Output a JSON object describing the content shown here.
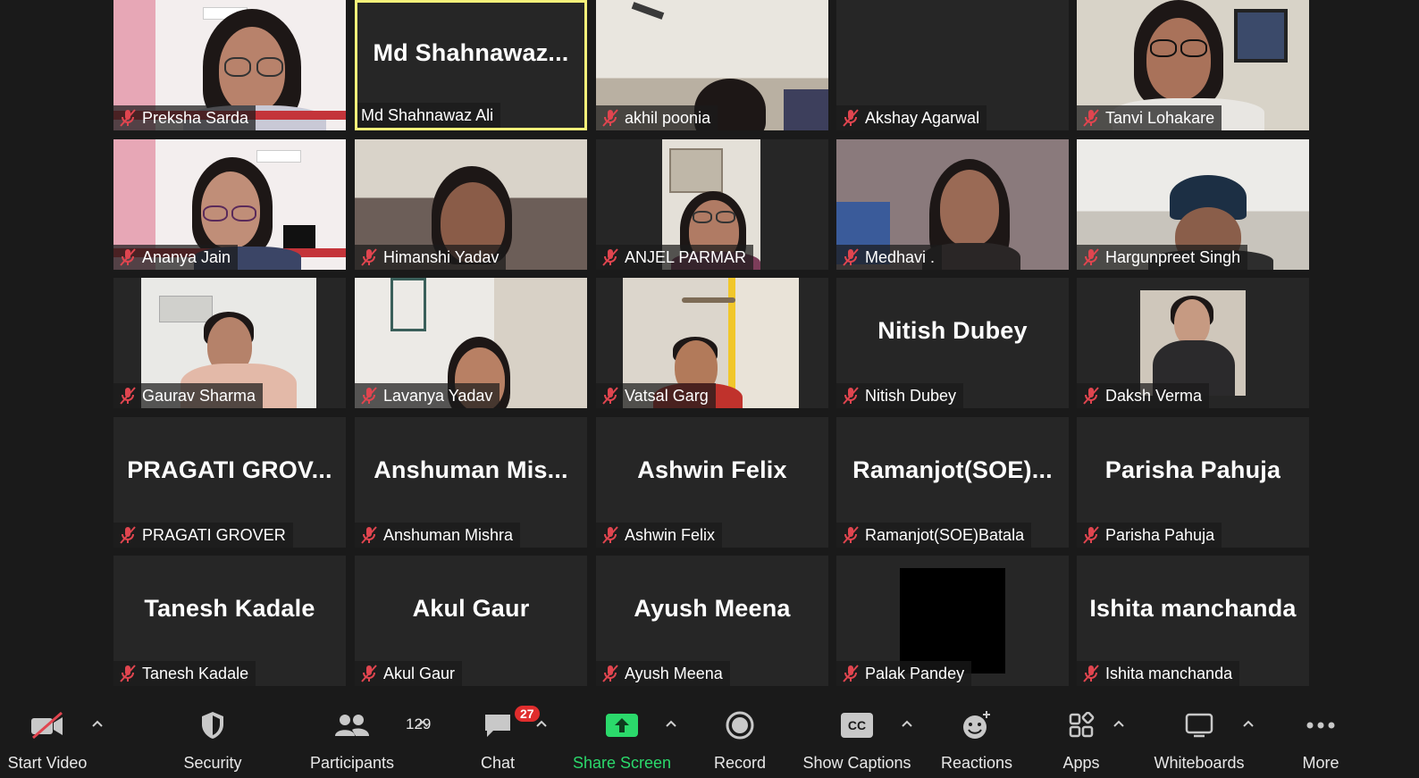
{
  "meeting": {
    "participants": [
      {
        "label": "Preksha Sarda",
        "display": "video",
        "muted": true
      },
      {
        "label": "Md Shahnawaz Ali",
        "display": "name",
        "big_name": "Md  Shahnawaz...",
        "muted": false,
        "active_speaker": true
      },
      {
        "label": "akhil poonia",
        "display": "video",
        "muted": true
      },
      {
        "label": "Akshay Agarwal",
        "display": "blank",
        "muted": true
      },
      {
        "label": "Tanvi Lohakare",
        "display": "video",
        "muted": true
      },
      {
        "label": "Ananya Jain",
        "display": "video",
        "muted": true
      },
      {
        "label": "Himanshi Yadav",
        "display": "video",
        "muted": true
      },
      {
        "label": "ANJEL PARMAR",
        "display": "video",
        "muted": true
      },
      {
        "label": "Medhavi .",
        "display": "video",
        "muted": true
      },
      {
        "label": "Hargunpreet Singh",
        "display": "video",
        "muted": true
      },
      {
        "label": "Gaurav Sharma",
        "display": "video",
        "muted": true
      },
      {
        "label": "Lavanya Yadav",
        "display": "video",
        "muted": true
      },
      {
        "label": "Vatsal Garg",
        "display": "video",
        "muted": true
      },
      {
        "label": "Nitish Dubey",
        "display": "name",
        "big_name": "Nitish Dubey",
        "muted": true
      },
      {
        "label": "Daksh Verma",
        "display": "video",
        "muted": true
      },
      {
        "label": "PRAGATI GROVER",
        "display": "name",
        "big_name": "PRAGATI  GROV...",
        "muted": true
      },
      {
        "label": "Anshuman Mishra",
        "display": "name",
        "big_name": "Anshuman  Mis...",
        "muted": true
      },
      {
        "label": "Ashwin Felix",
        "display": "name",
        "big_name": "Ashwin Felix",
        "muted": true
      },
      {
        "label": "Ramanjot(SOE)Batala",
        "display": "name",
        "big_name": "Ramanjot(SOE)...",
        "muted": true
      },
      {
        "label": "Parisha Pahuja",
        "display": "name",
        "big_name": "Parisha Pahuja",
        "muted": true
      },
      {
        "label": "Tanesh Kadale",
        "display": "name",
        "big_name": "Tanesh Kadale",
        "muted": true
      },
      {
        "label": "Akul Gaur",
        "display": "name",
        "big_name": "Akul Gaur",
        "muted": true
      },
      {
        "label": "Ayush Meena",
        "display": "name",
        "big_name": "Ayush Meena",
        "muted": true
      },
      {
        "label": "Palak Pandey",
        "display": "video",
        "muted": true
      },
      {
        "label": "Ishita manchanda",
        "display": "name",
        "big_name": "Ishita manchanda",
        "muted": true
      }
    ]
  },
  "toolbar": {
    "start_video": "Start Video",
    "security": "Security",
    "participants": "Participants",
    "participants_count": "129",
    "chat": "Chat",
    "chat_badge": "27",
    "share_screen": "Share Screen",
    "record": "Record",
    "show_captions": "Show Captions",
    "captions_icon_text": "CC",
    "reactions": "Reactions",
    "apps": "Apps",
    "whiteboards": "Whiteboards",
    "more": "More"
  },
  "colors": {
    "active_speaker_border": "#f5f07a",
    "muted_icon": "#e0454f",
    "share_green": "#2bd96b",
    "badge_red": "#e02d2d"
  }
}
